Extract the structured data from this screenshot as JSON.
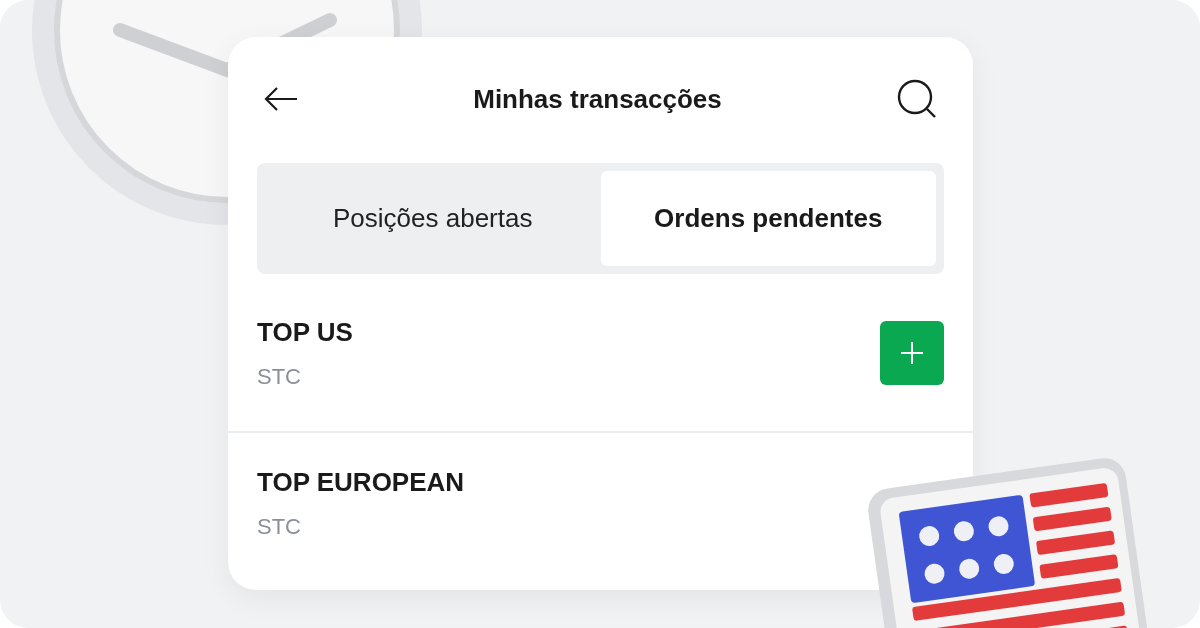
{
  "header": {
    "title": "Minhas transacções"
  },
  "tabs": [
    {
      "label": "Posições abertas",
      "selected": false
    },
    {
      "label": "Ordens pendentes",
      "selected": true
    }
  ],
  "rows": [
    {
      "name": "TOP US",
      "subtitle": "STC",
      "kind": "addable"
    },
    {
      "name": "TOP EUROPEAN",
      "subtitle": "STC",
      "kind": "plain"
    }
  ]
}
